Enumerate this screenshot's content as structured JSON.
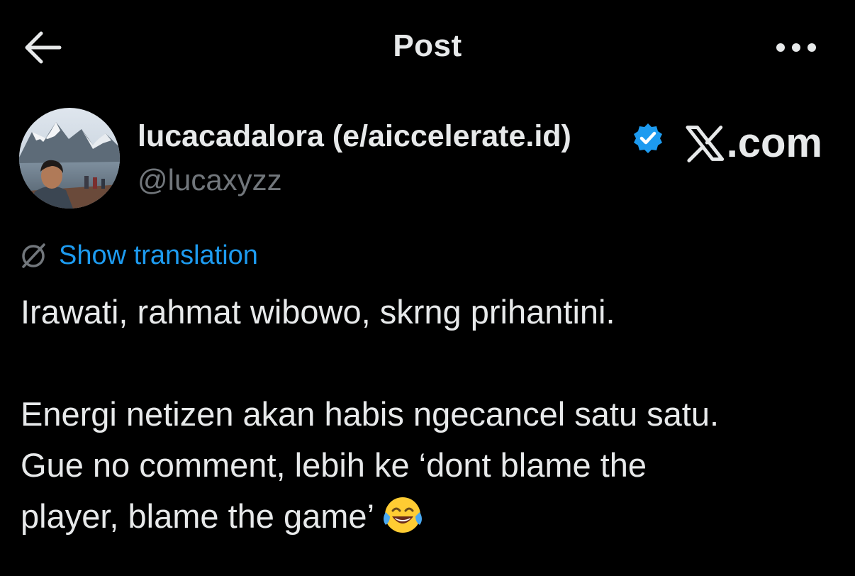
{
  "header": {
    "title": "Post",
    "back_icon": "arrow-left-icon",
    "more_icon": "more-horizontal-icon"
  },
  "author": {
    "display_name": "lucacadalora (e/aiccelerate.id)",
    "handle": "@lucaxyzz",
    "verified": true,
    "verified_icon": "verified-badge-icon",
    "avatar_icon": "avatar-photo"
  },
  "watermark": {
    "logo_icon": "x-logo-icon",
    "text": ".com"
  },
  "translation": {
    "label": "Show translation",
    "icon": "globe-slash-icon"
  },
  "post": {
    "lines": [
      "Irawati, rahmat wibowo, skrng prihantini.",
      "",
      "Energi netizen akan habis ngecancel satu satu.",
      "Gue no comment, lebih ke ‘dont blame the",
      "player, blame the game’"
    ],
    "trailing_emoji": "face-with-tears-of-joy-icon"
  },
  "colors": {
    "background": "#000000",
    "text": "#e7e9ea",
    "secondary_text": "#71767b",
    "accent": "#1d9bf0"
  }
}
